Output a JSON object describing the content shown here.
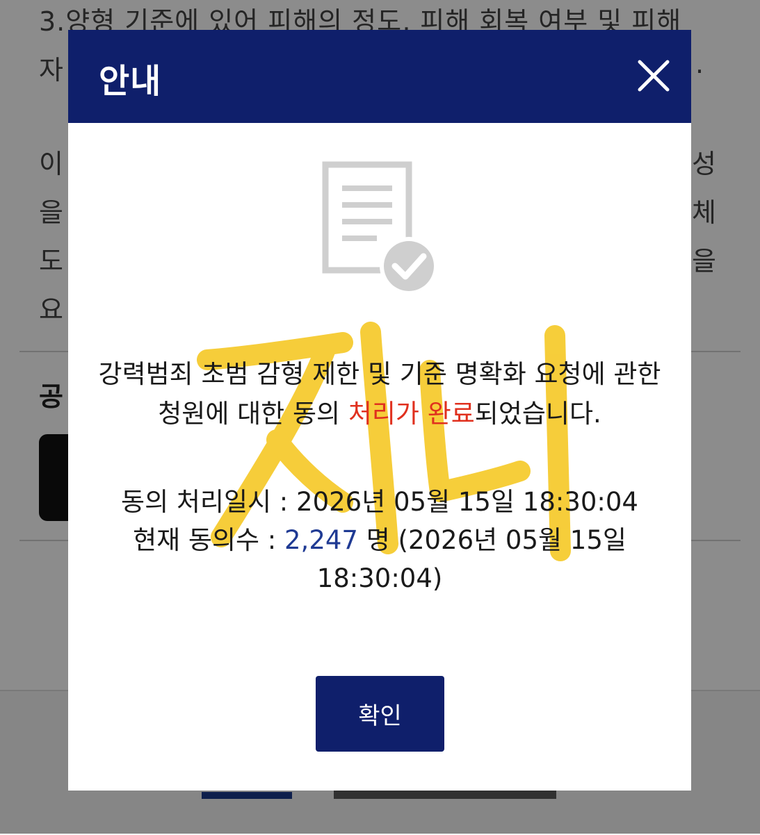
{
  "background": {
    "lines": [
      "3.양형 기준에 있어 피해의 정도, 피해 회복 여부 및 피해",
      "자",
      "이",
      "을",
      "도",
      "요"
    ],
    "right_fragments": [
      "성",
      "체",
      "을",
      "."
    ],
    "share_title": "공"
  },
  "modal": {
    "title": "안내",
    "close_icon": "close-icon",
    "document_icon": "document-check-icon",
    "watermark_text": "지니",
    "message": {
      "prefix": "강력범죄 초범 감형 제한 및 기준 명확화 요청에 관한 청원에 대한 동의 ",
      "highlight": "처리가 완료",
      "suffix": "되었습니다."
    },
    "processed_label": "동의 처리일시 : ",
    "processed_value": "2026년 05월 15일 18:30:04",
    "count_label": "현재 동의수 : ",
    "count_value": "2,247",
    "count_suffix": " 명 (2026년 05월 15일 18:30:04)",
    "confirm_label": "확인"
  },
  "colors": {
    "header_bg": "#0f1f6b",
    "button_bg": "#0f1f6b",
    "highlight": "#e0301e",
    "count": "#1f3a93",
    "watermark": "#f5c518",
    "icon_gray": "#cfcfcf"
  }
}
